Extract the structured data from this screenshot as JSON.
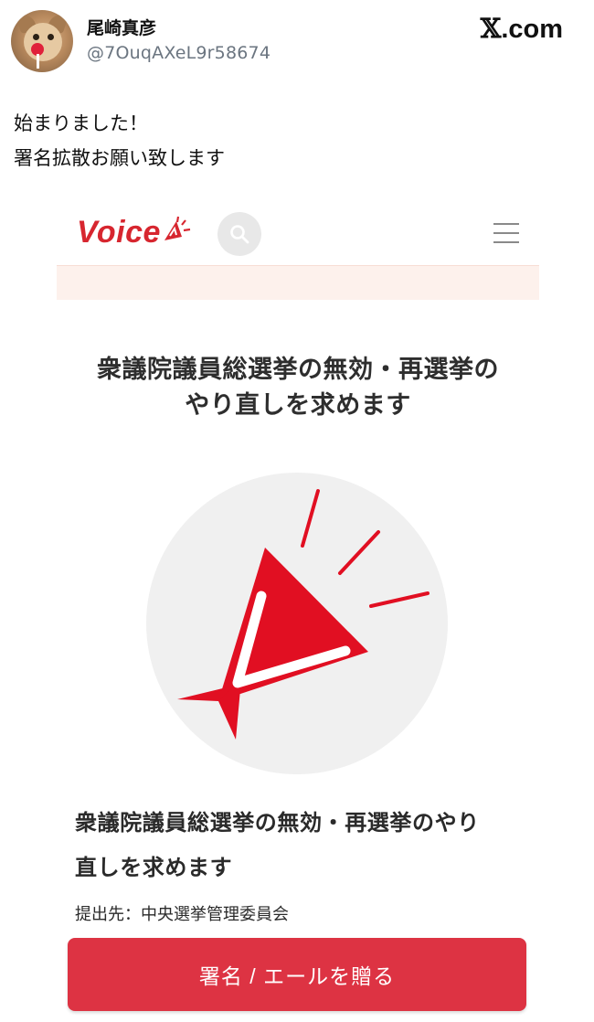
{
  "tweet": {
    "user_name": "尾崎真彦",
    "user_handle": "@7OuqAXeL9r58674",
    "brand_x": "𝕏",
    "brand_suffix": ".com",
    "text_lines": [
      "始まりました！",
      "署名拡散お願い致します"
    ]
  },
  "voice_page": {
    "logo_text": "Voice",
    "logo_icon": "megaphone-icon",
    "search_icon": "search-icon",
    "menu_icon": "hamburger-menu-icon",
    "title_lines": [
      "衆議院議員総選挙の無効・再選挙の",
      "やり直しを求めます"
    ],
    "hero_icon": "megaphone-icon",
    "subtitle_lines": [
      "衆議院議員総選挙の無効・再選挙のやり",
      "直しを求めます"
    ],
    "recipient": "提出先：中央選挙管理委員会",
    "sign_button_label": "署名 / エールを贈る"
  },
  "colors": {
    "brand_red": "#d7262f",
    "button_red": "#dd3343",
    "band_pink": "#fdf1ec",
    "hero_bg": "#f0f0f0",
    "handle_gray": "#6b7580"
  }
}
